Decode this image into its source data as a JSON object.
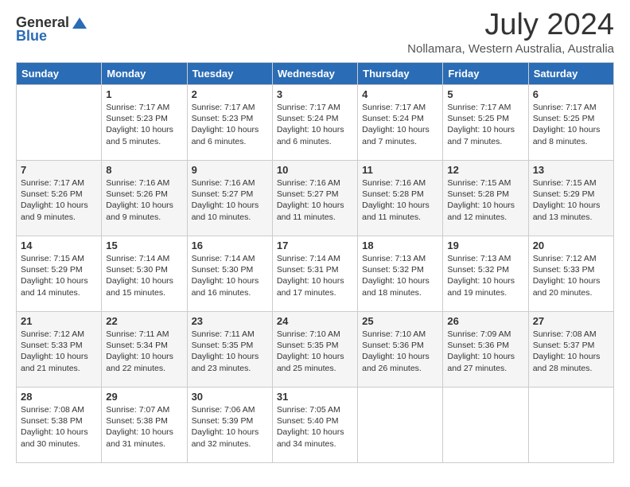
{
  "header": {
    "logo_general": "General",
    "logo_blue": "Blue",
    "month_title": "July 2024",
    "subtitle": "Nollamara, Western Australia, Australia"
  },
  "weekdays": [
    "Sunday",
    "Monday",
    "Tuesday",
    "Wednesday",
    "Thursday",
    "Friday",
    "Saturday"
  ],
  "weeks": [
    [
      {
        "day": "",
        "info": ""
      },
      {
        "day": "1",
        "info": "Sunrise: 7:17 AM\nSunset: 5:23 PM\nDaylight: 10 hours\nand 5 minutes."
      },
      {
        "day": "2",
        "info": "Sunrise: 7:17 AM\nSunset: 5:23 PM\nDaylight: 10 hours\nand 6 minutes."
      },
      {
        "day": "3",
        "info": "Sunrise: 7:17 AM\nSunset: 5:24 PM\nDaylight: 10 hours\nand 6 minutes."
      },
      {
        "day": "4",
        "info": "Sunrise: 7:17 AM\nSunset: 5:24 PM\nDaylight: 10 hours\nand 7 minutes."
      },
      {
        "day": "5",
        "info": "Sunrise: 7:17 AM\nSunset: 5:25 PM\nDaylight: 10 hours\nand 7 minutes."
      },
      {
        "day": "6",
        "info": "Sunrise: 7:17 AM\nSunset: 5:25 PM\nDaylight: 10 hours\nand 8 minutes."
      }
    ],
    [
      {
        "day": "7",
        "info": "Sunrise: 7:17 AM\nSunset: 5:26 PM\nDaylight: 10 hours\nand 9 minutes."
      },
      {
        "day": "8",
        "info": "Sunrise: 7:16 AM\nSunset: 5:26 PM\nDaylight: 10 hours\nand 9 minutes."
      },
      {
        "day": "9",
        "info": "Sunrise: 7:16 AM\nSunset: 5:27 PM\nDaylight: 10 hours\nand 10 minutes."
      },
      {
        "day": "10",
        "info": "Sunrise: 7:16 AM\nSunset: 5:27 PM\nDaylight: 10 hours\nand 11 minutes."
      },
      {
        "day": "11",
        "info": "Sunrise: 7:16 AM\nSunset: 5:28 PM\nDaylight: 10 hours\nand 11 minutes."
      },
      {
        "day": "12",
        "info": "Sunrise: 7:15 AM\nSunset: 5:28 PM\nDaylight: 10 hours\nand 12 minutes."
      },
      {
        "day": "13",
        "info": "Sunrise: 7:15 AM\nSunset: 5:29 PM\nDaylight: 10 hours\nand 13 minutes."
      }
    ],
    [
      {
        "day": "14",
        "info": "Sunrise: 7:15 AM\nSunset: 5:29 PM\nDaylight: 10 hours\nand 14 minutes."
      },
      {
        "day": "15",
        "info": "Sunrise: 7:14 AM\nSunset: 5:30 PM\nDaylight: 10 hours\nand 15 minutes."
      },
      {
        "day": "16",
        "info": "Sunrise: 7:14 AM\nSunset: 5:30 PM\nDaylight: 10 hours\nand 16 minutes."
      },
      {
        "day": "17",
        "info": "Sunrise: 7:14 AM\nSunset: 5:31 PM\nDaylight: 10 hours\nand 17 minutes."
      },
      {
        "day": "18",
        "info": "Sunrise: 7:13 AM\nSunset: 5:32 PM\nDaylight: 10 hours\nand 18 minutes."
      },
      {
        "day": "19",
        "info": "Sunrise: 7:13 AM\nSunset: 5:32 PM\nDaylight: 10 hours\nand 19 minutes."
      },
      {
        "day": "20",
        "info": "Sunrise: 7:12 AM\nSunset: 5:33 PM\nDaylight: 10 hours\nand 20 minutes."
      }
    ],
    [
      {
        "day": "21",
        "info": "Sunrise: 7:12 AM\nSunset: 5:33 PM\nDaylight: 10 hours\nand 21 minutes."
      },
      {
        "day": "22",
        "info": "Sunrise: 7:11 AM\nSunset: 5:34 PM\nDaylight: 10 hours\nand 22 minutes."
      },
      {
        "day": "23",
        "info": "Sunrise: 7:11 AM\nSunset: 5:35 PM\nDaylight: 10 hours\nand 23 minutes."
      },
      {
        "day": "24",
        "info": "Sunrise: 7:10 AM\nSunset: 5:35 PM\nDaylight: 10 hours\nand 25 minutes."
      },
      {
        "day": "25",
        "info": "Sunrise: 7:10 AM\nSunset: 5:36 PM\nDaylight: 10 hours\nand 26 minutes."
      },
      {
        "day": "26",
        "info": "Sunrise: 7:09 AM\nSunset: 5:36 PM\nDaylight: 10 hours\nand 27 minutes."
      },
      {
        "day": "27",
        "info": "Sunrise: 7:08 AM\nSunset: 5:37 PM\nDaylight: 10 hours\nand 28 minutes."
      }
    ],
    [
      {
        "day": "28",
        "info": "Sunrise: 7:08 AM\nSunset: 5:38 PM\nDaylight: 10 hours\nand 30 minutes."
      },
      {
        "day": "29",
        "info": "Sunrise: 7:07 AM\nSunset: 5:38 PM\nDaylight: 10 hours\nand 31 minutes."
      },
      {
        "day": "30",
        "info": "Sunrise: 7:06 AM\nSunset: 5:39 PM\nDaylight: 10 hours\nand 32 minutes."
      },
      {
        "day": "31",
        "info": "Sunrise: 7:05 AM\nSunset: 5:40 PM\nDaylight: 10 hours\nand 34 minutes."
      },
      {
        "day": "",
        "info": ""
      },
      {
        "day": "",
        "info": ""
      },
      {
        "day": "",
        "info": ""
      }
    ]
  ]
}
